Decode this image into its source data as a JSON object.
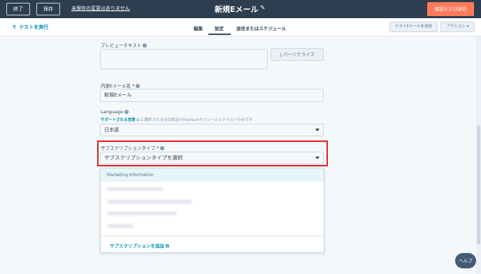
{
  "topbar": {
    "exit_label": "終了",
    "save_label": "保存",
    "unsaved_text": "未保存の変更はありません",
    "email_title": "新規Eメール",
    "review_send_label": "確認および送信"
  },
  "subbar": {
    "test_run_label": "テストを実行",
    "tabs": [
      {
        "label": "編集"
      },
      {
        "label": "設定"
      },
      {
        "label": "送信またはスケジュール"
      }
    ],
    "test_email_label": "テストEメールを送信",
    "actions_label": "アクション"
  },
  "form": {
    "preview_text_label": "プレビューテキスト",
    "preview_text_value": "",
    "personalize_label": "パーソナライズ",
    "internal_name_label": "内部Eメール名",
    "internal_name_value": "新規Eメール",
    "language_label": "Language",
    "language_help_link": "サポートされる言語",
    "language_help_text": "に翻訳されるのは既定のHubSpotモジュールとテキストのみです",
    "language_value": "日本語",
    "subscription_label": "サブスクリプションタイプ",
    "subscription_placeholder": "サブスクリプションタイプを選択",
    "required_mark": "*"
  },
  "dropdown": {
    "group_header": "Marketing Information",
    "add_subscription_label": "サブスクリプションを追加"
  },
  "help_bubble_label": "ヘルプ",
  "colors": {
    "topbar": "#2d3e50",
    "accent": "#ff7a59",
    "link": "#0091ae",
    "highlight": "#e02020"
  }
}
